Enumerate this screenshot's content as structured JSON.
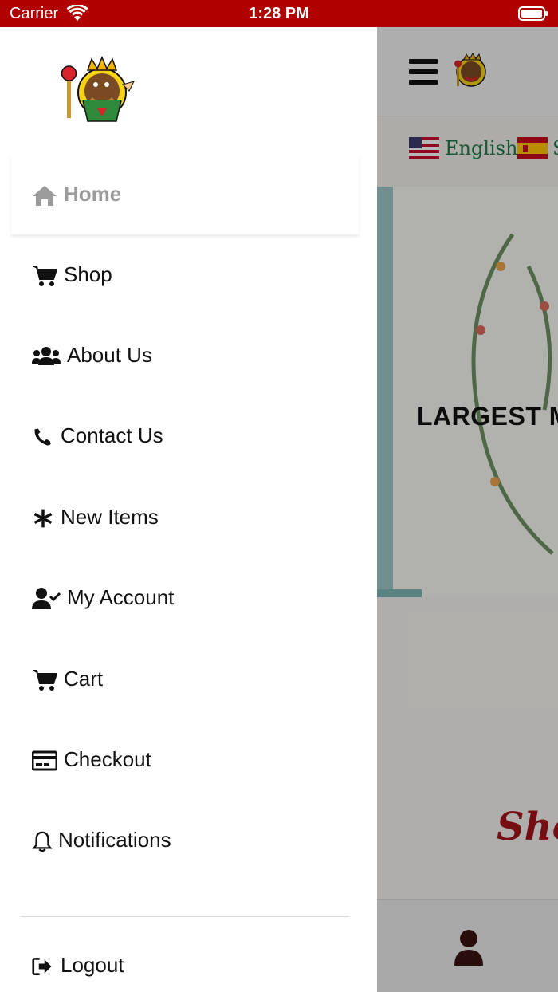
{
  "status_bar": {
    "carrier": "Carrier",
    "time": "1:28 PM"
  },
  "drawer": {
    "items": [
      {
        "label": "Home",
        "icon": "home-icon",
        "active": true
      },
      {
        "label": "Shop",
        "icon": "cart-icon"
      },
      {
        "label": "About Us",
        "icon": "users-icon"
      },
      {
        "label": "Contact Us",
        "icon": "phone-icon"
      },
      {
        "label": "New Items",
        "icon": "asterisk-icon"
      },
      {
        "label": "My Account",
        "icon": "user-check-icon"
      },
      {
        "label": "Cart",
        "icon": "cart-icon"
      },
      {
        "label": "Checkout",
        "icon": "credit-card-icon"
      },
      {
        "label": "Notifications",
        "icon": "bell-icon"
      }
    ],
    "logout_label": "Logout"
  },
  "background_app": {
    "language_english": "English",
    "language_spanish_partial": "S",
    "hero_text": "LARGEST MI",
    "shop_text": "Sho"
  },
  "colors": {
    "status_bar": "#b00000",
    "active_item": "#9b9b9b",
    "language_text": "#1e7b47",
    "shop_text": "#a31419"
  }
}
